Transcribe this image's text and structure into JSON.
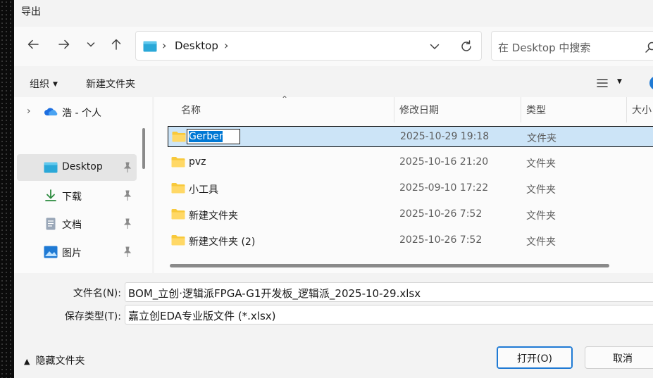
{
  "window": {
    "title": "导出"
  },
  "nav": {
    "address_path": "Desktop",
    "search_placeholder": "在 Desktop 中搜索"
  },
  "toolbar": {
    "organize_label": "组织",
    "new_folder_label": "新建文件夹"
  },
  "sidebar": {
    "items": [
      {
        "label": "浩 - 个人",
        "icon": "onedrive-cloud-icon",
        "pinned": false,
        "expandable": true
      },
      {
        "label": "Desktop",
        "icon": "desktop-folder-icon",
        "pinned": true,
        "selected": true
      },
      {
        "label": "下载",
        "icon": "download-arrow-icon",
        "pinned": true
      },
      {
        "label": "文档",
        "icon": "document-icon",
        "pinned": true
      },
      {
        "label": "图片",
        "icon": "picture-icon",
        "pinned": true
      }
    ]
  },
  "file_list": {
    "columns": [
      "名称",
      "修改日期",
      "类型",
      "大小"
    ],
    "rows": [
      {
        "name": "Gerber",
        "date": "2025-10-29 19:18",
        "type": "文件夹",
        "selected": true,
        "editing": true
      },
      {
        "name": "pvz",
        "date": "2025-10-16 21:20",
        "type": "文件夹"
      },
      {
        "name": "小工具",
        "date": "2025-09-10 17:22",
        "type": "文件夹"
      },
      {
        "name": "新建文件夹",
        "date": "2025-10-26 7:52",
        "type": "文件夹"
      },
      {
        "name": "新建文件夹 (2)",
        "date": "2025-10-26 7:52",
        "type": "文件夹"
      }
    ]
  },
  "form": {
    "filename_label": "文件名(N):",
    "filename_value": "BOM_立创·逻辑派FPGA-G1开发板_逻辑派_2025-10-29.xlsx",
    "filetype_label": "保存类型(T):",
    "filetype_value": "嘉立创EDA专业版文件 (*.xlsx)"
  },
  "footer": {
    "hide_folders_label": "隐藏文件夹",
    "open_button": "打开(O)",
    "cancel_button": "取消"
  },
  "colors": {
    "accent": "#0078d4",
    "selection_bg": "#cce4f7",
    "folder_yellow": "#f8c93b"
  }
}
